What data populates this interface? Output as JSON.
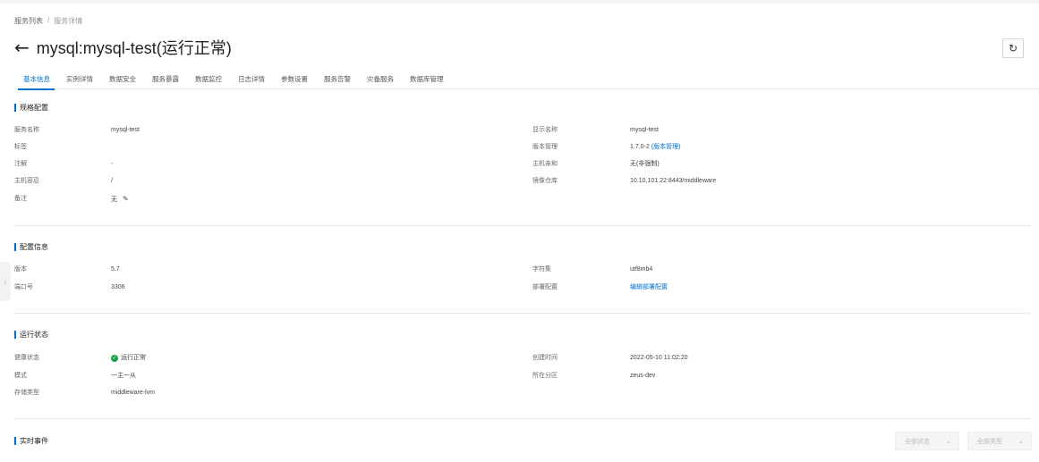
{
  "breadcrumb": {
    "parent": "服务列表",
    "separator": "/",
    "current": "服务详情"
  },
  "title": {
    "back_icon": "←",
    "text": "mysql:mysql-test(运行正常)"
  },
  "refresh_icon": "↻",
  "tabs": [
    {
      "label": "基本信息"
    },
    {
      "label": "实例详情"
    },
    {
      "label": "数据安全"
    },
    {
      "label": "服务暴露"
    },
    {
      "label": "数据监控"
    },
    {
      "label": "日志详情"
    },
    {
      "label": "参数设置"
    },
    {
      "label": "服务告警"
    },
    {
      "label": "灾备服务"
    },
    {
      "label": "数据库管理"
    }
  ],
  "spec": {
    "title": "规格配置",
    "service_name_label": "服务名称",
    "service_name": "mysql-test",
    "tags_label": "标签",
    "annotation_label": "注解",
    "annotation": "-",
    "tolerance_label": "主机容忍",
    "tolerance": "/",
    "remark_label": "备注",
    "remark": "无",
    "display_name_label": "显示名称",
    "display_name": "mysql-test",
    "version_mgmt_label": "版本管理",
    "version_mgmt": "1.7.0-2",
    "version_mgmt_link": "(版本管理)",
    "affinity_label": "主机亲和",
    "affinity": "无(非强制)",
    "registry_label": "镜像仓库",
    "registry": "10.10.101.22:8443/middleware"
  },
  "config": {
    "title": "配置信息",
    "version_label": "版本",
    "version": "5.7",
    "port_label": "端口号",
    "port": "3306",
    "charset_label": "字符集",
    "charset": "utf8mb4",
    "deploy_label": "部署配置",
    "deploy_link": "编辑部署配置"
  },
  "runtime": {
    "title": "运行状态",
    "health_label": "健康状态",
    "health": "运行正常",
    "mode_label": "模式",
    "mode": "一主一从",
    "storage_label": "存储类型",
    "storage": "middleware-lvm",
    "created_label": "创建时间",
    "created": "2022-05-10 11:02:20",
    "partition_label": "所在分区",
    "partition": "zeus-dev"
  },
  "events": {
    "title": "实时事件",
    "status_filter": "全部状态",
    "type_filter": "全部类型"
  }
}
